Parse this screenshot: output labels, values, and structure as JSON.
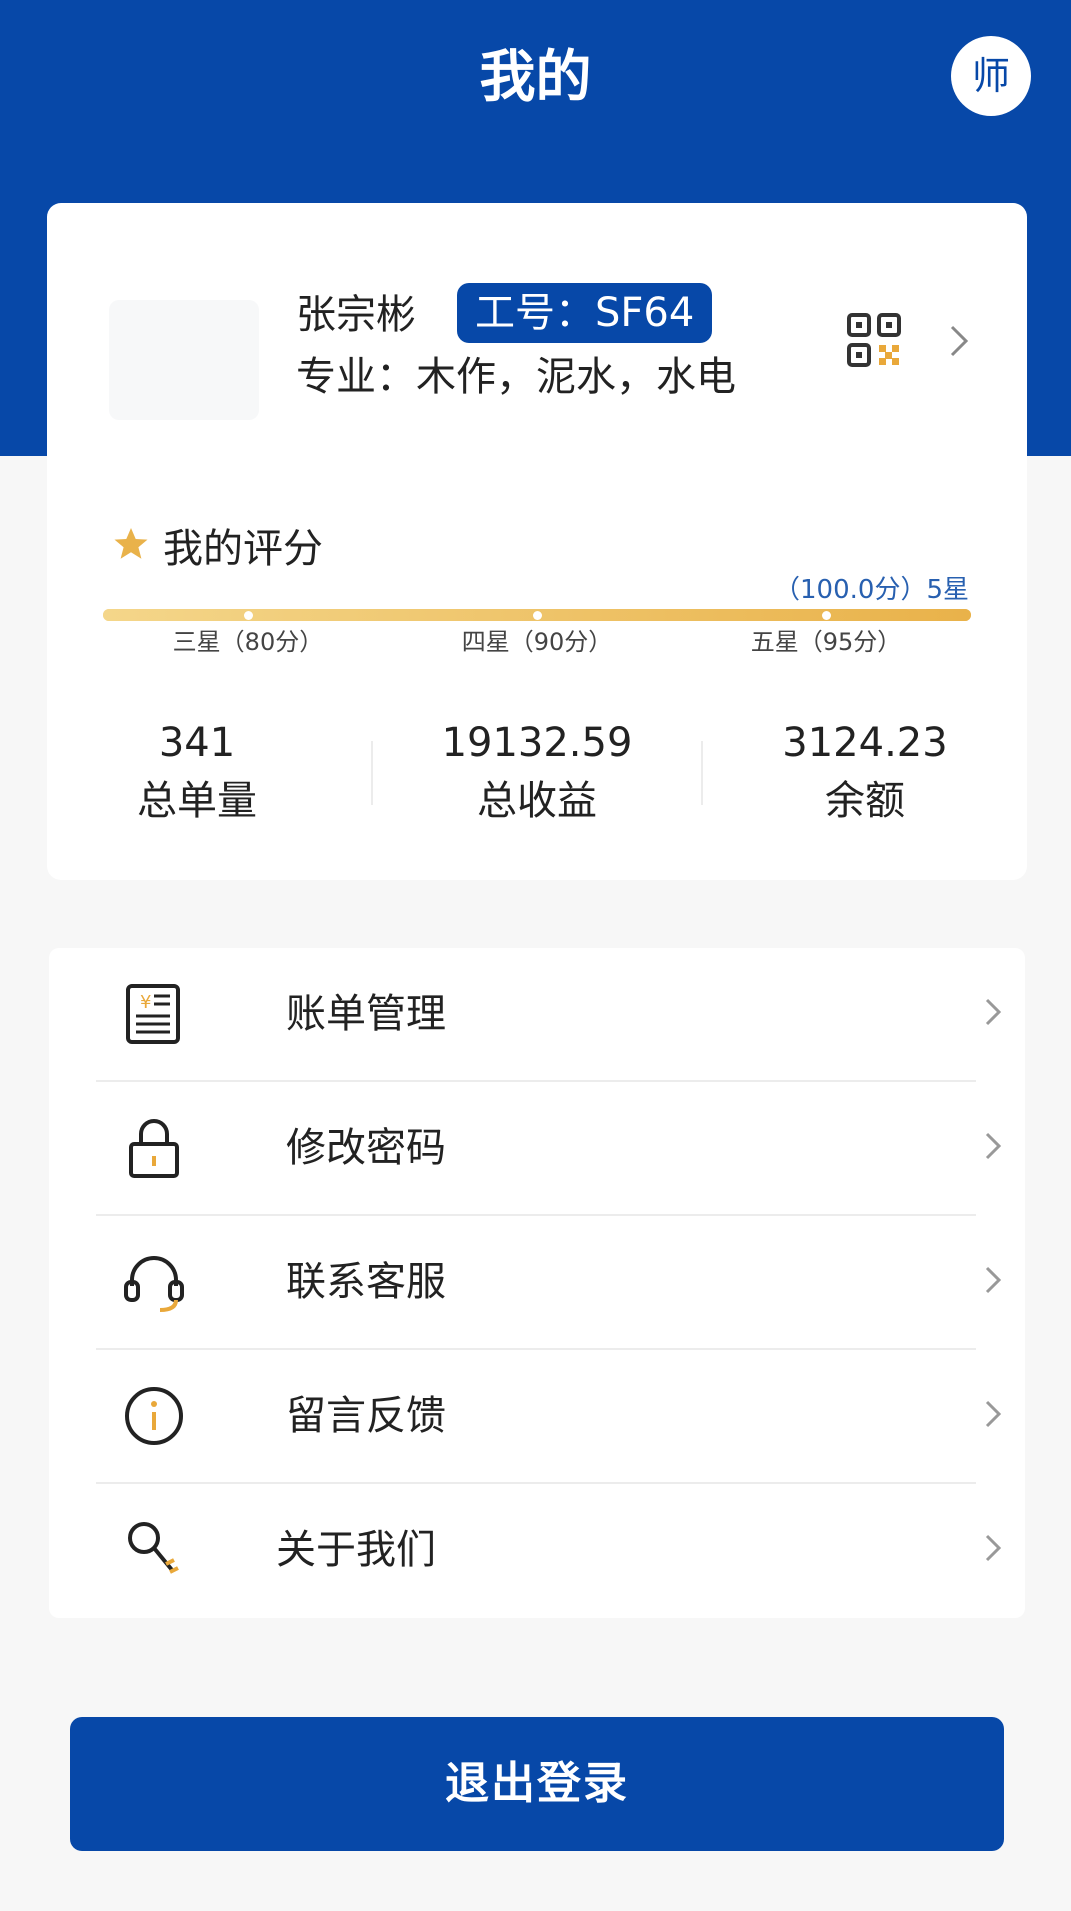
{
  "header": {
    "title": "我的",
    "role_badge": "师",
    "color": "#0748a8"
  },
  "profile": {
    "name": "张宗彬",
    "employee_id": "工号：SF64",
    "specialty": "专业：木作，泥水，水电",
    "qr_icon": "qr-code-icon",
    "chevron_icon": "chevron-right-icon"
  },
  "rating": {
    "title": "我的评分",
    "score_label": "（100.0分）5星",
    "score_fraction": 1.0,
    "ticks": [
      {
        "label": "三星（80分）",
        "fraction": 0.167
      },
      {
        "label": "四星（90分）",
        "fraction": 0.5
      },
      {
        "label": "五星（95分）",
        "fraction": 0.833
      }
    ],
    "accent_color": "#ebb54a"
  },
  "stats": [
    {
      "value": "341",
      "label": "总单量"
    },
    {
      "value": "19132.59",
      "label": "总收益"
    },
    {
      "value": "3124.23",
      "label": "余额"
    }
  ],
  "menu": [
    {
      "label": "账单管理",
      "icon": "bill-icon"
    },
    {
      "label": "修改密码",
      "icon": "lock-icon"
    },
    {
      "label": "联系客服",
      "icon": "headset-icon"
    },
    {
      "label": "留言反馈",
      "icon": "info-icon"
    },
    {
      "label": "关于我们",
      "icon": "about-key-icon"
    }
  ],
  "logout": {
    "label": "退出登录"
  }
}
